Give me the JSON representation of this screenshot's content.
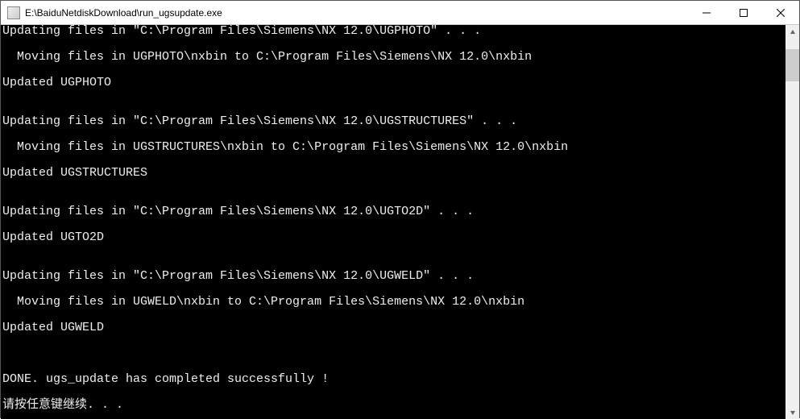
{
  "titlebar": {
    "title": "E:\\BaiduNetdiskDownload\\run_ugsupdate.exe"
  },
  "console": {
    "lines": [
      "Updating files in \"C:\\Program Files\\Siemens\\NX 12.0\\UGPHOTO\" . . .",
      "",
      "  Moving files in UGPHOTO\\nxbin to C:\\Program Files\\Siemens\\NX 12.0\\nxbin",
      "",
      "Updated UGPHOTO",
      "",
      "",
      "Updating files in \"C:\\Program Files\\Siemens\\NX 12.0\\UGSTRUCTURES\" . . .",
      "",
      "  Moving files in UGSTRUCTURES\\nxbin to C:\\Program Files\\Siemens\\NX 12.0\\nxbin",
      "",
      "Updated UGSTRUCTURES",
      "",
      "",
      "Updating files in \"C:\\Program Files\\Siemens\\NX 12.0\\UGTO2D\" . . .",
      "",
      "Updated UGTO2D",
      "",
      "",
      "Updating files in \"C:\\Program Files\\Siemens\\NX 12.0\\UGWELD\" . . .",
      "",
      "  Moving files in UGWELD\\nxbin to C:\\Program Files\\Siemens\\NX 12.0\\nxbin",
      "",
      "Updated UGWELD",
      "",
      "",
      "",
      "DONE. ugs_update has completed successfully !",
      "",
      "请按任意键继续. . ."
    ]
  }
}
